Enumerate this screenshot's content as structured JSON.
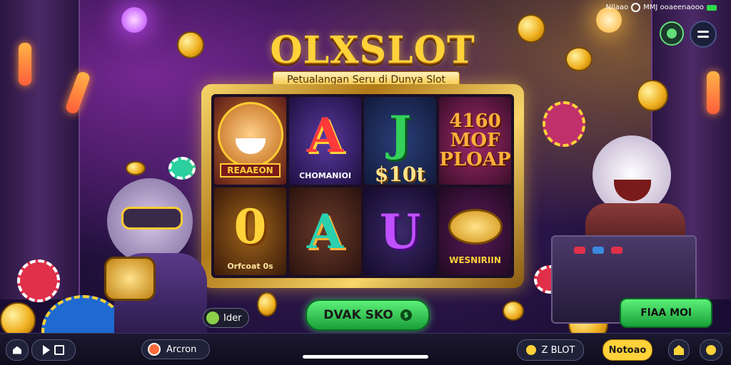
{
  "status": {
    "text": "NIlaao",
    "carrier": "MMJ ooaeenaooo"
  },
  "game": {
    "title": "OLXSLOT",
    "subtitle": "Petualangan Seru di Dunya Slot"
  },
  "reels": {
    "r1c1_label": "REAAEON",
    "r1c2_symbol": "A",
    "r1c2_label": "CHOMANIOI",
    "r1c3_symbol": "J",
    "r1c3_label": "$10t",
    "r1c4_text": "4160 MOF PLOAP",
    "r2c1_symbol": "0",
    "r2c1_label": "Orfcoat 0s",
    "r2c2_symbol": "A",
    "r2c3_symbol": "U",
    "r2c4_label": "WESNIRIIN"
  },
  "buttons": {
    "mini_badge": "Ider",
    "main_cta": "DVAK SKO",
    "side_cta": "FlAA MOl"
  },
  "bottom_bar": {
    "account": "Arcron",
    "balance": "Z BLOT",
    "yellow_btn": "Notoao"
  },
  "colors": {
    "accent_gold": "#ffd23a",
    "cta_green": "#1aa03a",
    "bg_purple": "#2a1540"
  }
}
